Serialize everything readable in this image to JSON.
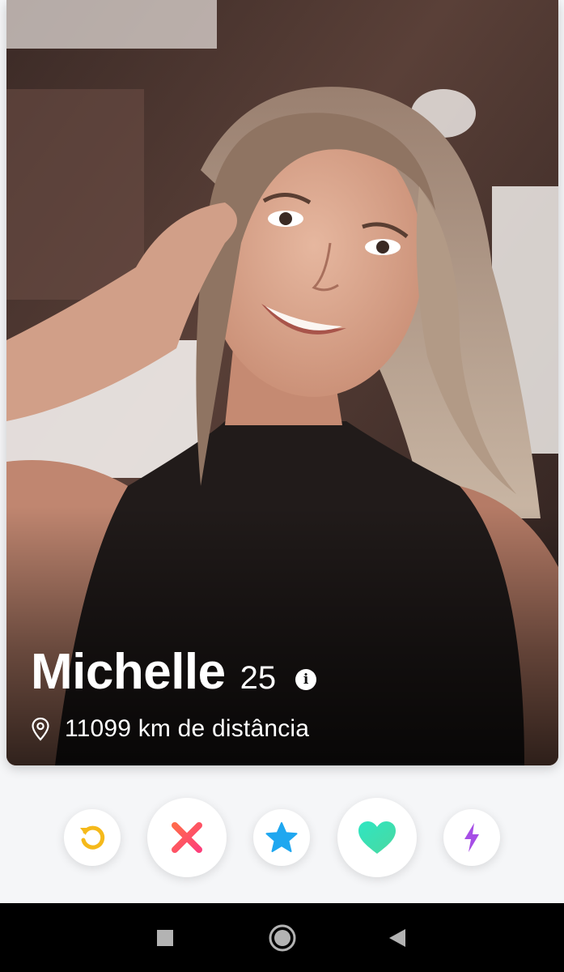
{
  "profile": {
    "name": "Michelle",
    "age": "25",
    "info_icon_glyph": "i",
    "distance": "11099 km de distância",
    "photo": "portrait-photo"
  },
  "actions": [
    {
      "name": "rewind-button",
      "icon": "rewind-icon",
      "color": "#f5b91a"
    },
    {
      "name": "nope-button",
      "icon": "close-icon",
      "color": "#fd4f68"
    },
    {
      "name": "super-like-button",
      "icon": "star-icon",
      "color": "#1fa7f0"
    },
    {
      "name": "like-button",
      "icon": "heart-icon",
      "color": "#3ee0b0"
    },
    {
      "name": "boost-button",
      "icon": "lightning-icon",
      "color": "#a64ee6"
    }
  ],
  "navbar": {
    "buttons": [
      "recents-square-icon",
      "home-circle-icon",
      "back-triangle-icon"
    ]
  }
}
